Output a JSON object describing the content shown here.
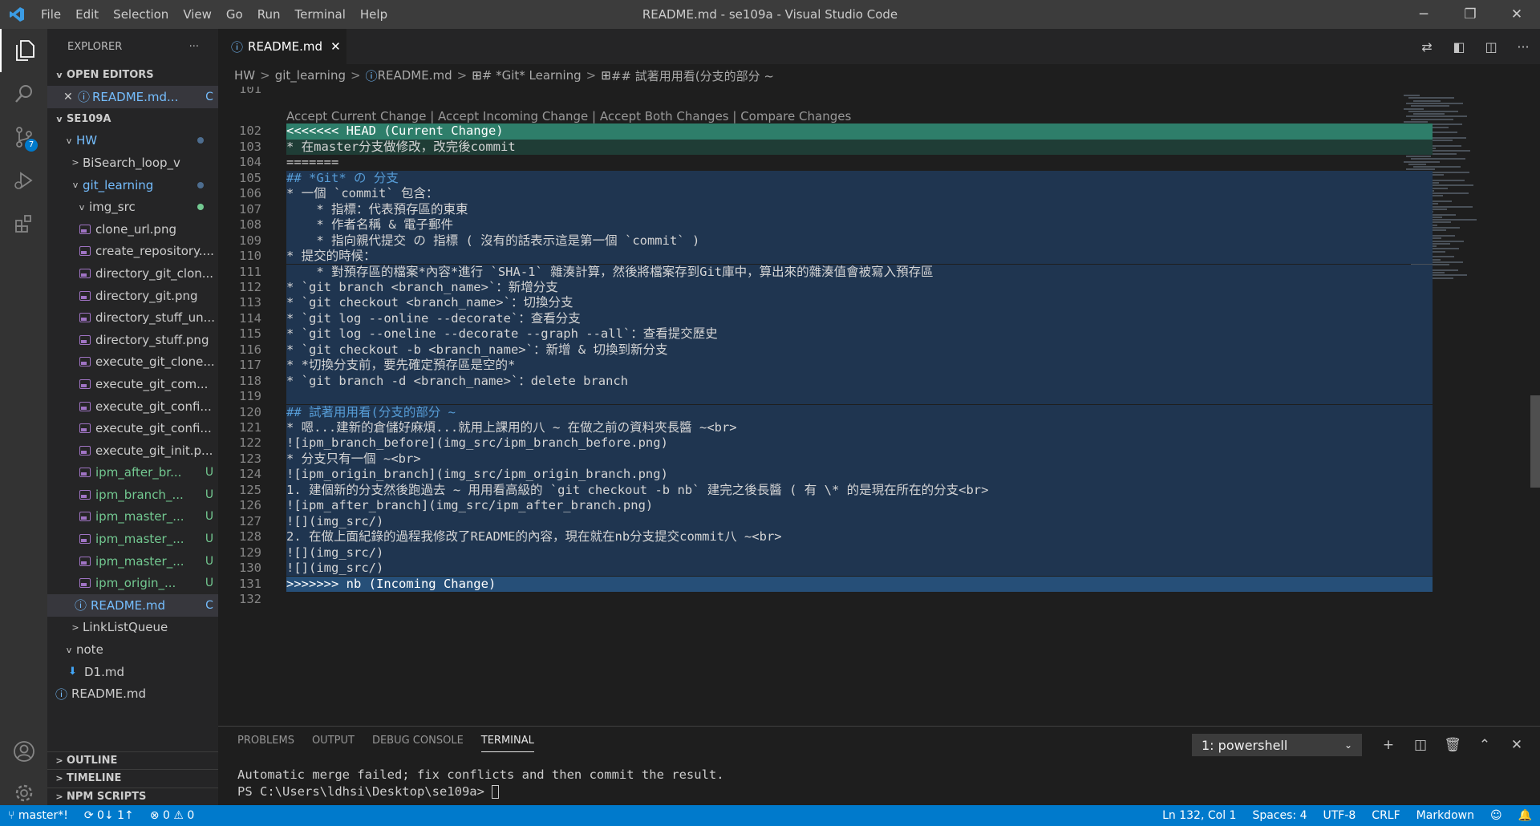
{
  "window_title": "README.md - se109a - Visual Studio Code",
  "menu": [
    "File",
    "Edit",
    "Selection",
    "View",
    "Go",
    "Run",
    "Terminal",
    "Help"
  ],
  "explorer": {
    "title": "EXPLORER",
    "more": "···",
    "open_editors_label": "OPEN EDITORS",
    "open_editor": {
      "name": "README.md...",
      "status": "C"
    },
    "workspace_label": "SE109A",
    "tree": [
      {
        "label": "HW",
        "indent": 18,
        "chevron": "v",
        "kind": "folder",
        "color": "#75beff",
        "dot": "#4d6d8f"
      },
      {
        "label": "BiSearch_loop_v",
        "indent": 26,
        "chevron": ">",
        "kind": "folder",
        "color": "#cccccc"
      },
      {
        "label": "git_learning",
        "indent": 26,
        "chevron": "v",
        "kind": "folder",
        "color": "#75beff",
        "dot": "#4d6d8f"
      },
      {
        "label": "img_src",
        "indent": 34,
        "chevron": "v",
        "kind": "folder",
        "color": "#cccccc",
        "dot": "#73c991"
      },
      {
        "label": "clone_url.png",
        "indent": 40,
        "kind": "file",
        "color": "#cccccc"
      },
      {
        "label": "create_repository....",
        "indent": 40,
        "kind": "file",
        "color": "#cccccc"
      },
      {
        "label": "directory_git_clon...",
        "indent": 40,
        "kind": "file",
        "color": "#cccccc"
      },
      {
        "label": "directory_git.png",
        "indent": 40,
        "kind": "file",
        "color": "#cccccc"
      },
      {
        "label": "directory_stuff_un...",
        "indent": 40,
        "kind": "file",
        "color": "#cccccc"
      },
      {
        "label": "directory_stuff.png",
        "indent": 40,
        "kind": "file",
        "color": "#cccccc"
      },
      {
        "label": "execute_git_clone...",
        "indent": 40,
        "kind": "file",
        "color": "#cccccc"
      },
      {
        "label": "execute_git_com...",
        "indent": 40,
        "kind": "file",
        "color": "#cccccc"
      },
      {
        "label": "execute_git_confi...",
        "indent": 40,
        "kind": "file",
        "color": "#cccccc"
      },
      {
        "label": "execute_git_confi...",
        "indent": 40,
        "kind": "file",
        "color": "#cccccc"
      },
      {
        "label": "execute_git_init.p...",
        "indent": 40,
        "kind": "file",
        "color": "#cccccc"
      },
      {
        "label": "ipm_after_br...",
        "indent": 40,
        "kind": "file",
        "color": "#73c991",
        "status": "U"
      },
      {
        "label": "ipm_branch_...",
        "indent": 40,
        "kind": "file",
        "color": "#73c991",
        "status": "U"
      },
      {
        "label": "ipm_master_...",
        "indent": 40,
        "kind": "file",
        "color": "#73c991",
        "status": "U"
      },
      {
        "label": "ipm_master_...",
        "indent": 40,
        "kind": "file",
        "color": "#73c991",
        "status": "U"
      },
      {
        "label": "ipm_master_...",
        "indent": 40,
        "kind": "file",
        "color": "#73c991",
        "status": "U"
      },
      {
        "label": "ipm_origin_...",
        "indent": 40,
        "kind": "file",
        "color": "#73c991",
        "status": "U"
      },
      {
        "label": "README.md",
        "indent": 34,
        "kind": "info",
        "color": "#75beff",
        "status": "C",
        "selected": true
      },
      {
        "label": "LinkListQueue",
        "indent": 26,
        "chevron": ">",
        "kind": "folder",
        "color": "#cccccc"
      },
      {
        "label": "note",
        "indent": 18,
        "chevron": "v",
        "kind": "folder",
        "color": "#cccccc"
      },
      {
        "label": "D1.md",
        "indent": 26,
        "kind": "md",
        "color": "#cccccc"
      },
      {
        "label": "README.md",
        "indent": 10,
        "kind": "info",
        "color": "#cccccc"
      }
    ],
    "bottom_sections": [
      "OUTLINE",
      "TIMELINE",
      "NPM SCRIPTS"
    ]
  },
  "activity": {
    "scm_badge": "7"
  },
  "tab": {
    "label": "README.md",
    "close": "✕"
  },
  "breadcrumbs": [
    "HW",
    "git_learning",
    "README.md",
    "# *Git* Learning",
    "## 試著用用看(分支的部分 ~"
  ],
  "codelens": "Accept Current Change | Accept Incoming Change | Accept Both Changes | Compare Changes",
  "lines": [
    {
      "n": "101",
      "t": "",
      "bg": ""
    },
    {
      "n": "102",
      "t": "<<<<<<< HEAD (Current Change)",
      "bg": "cur"
    },
    {
      "n": "103",
      "t": "* 在master分支做修改，改完後commit",
      "bg": "curb"
    },
    {
      "n": "104",
      "t": "=======",
      "bg": ""
    },
    {
      "n": "105",
      "t": "## *Git* の 分支",
      "bg": "incb",
      "cls": "kw"
    },
    {
      "n": "106",
      "t": "* 一個 `commit` 包含：",
      "bg": "incb"
    },
    {
      "n": "107",
      "t": "    * 指標：代表預存區的東東",
      "bg": "incb"
    },
    {
      "n": "108",
      "t": "    * 作者名稱 & 電子郵件",
      "bg": "incb"
    },
    {
      "n": "109",
      "t": "    * 指向親代提交 の 指標 ( 沒有的話表示這是第一個 `commit` )",
      "bg": "incb"
    },
    {
      "n": "110",
      "t": "* 提交的時候：",
      "bg": "incb"
    },
    {
      "n": "111",
      "t": "    * 對預存區的檔案*內容*進行 `SHA-1` 雜湊計算，然後將檔案存到Git庫中，算出來的雜湊值會被寫入預存區",
      "bg": "incb"
    },
    {
      "n": "112",
      "t": "* `git branch <branch_name>`：新增分支",
      "bg": "incb"
    },
    {
      "n": "113",
      "t": "* `git checkout <branch_name>`：切換分支",
      "bg": "incb"
    },
    {
      "n": "114",
      "t": "* `git log --online --decorate`：查看分支",
      "bg": "incb"
    },
    {
      "n": "115",
      "t": "* `git log --oneline --decorate --graph --all`：查看提交歷史",
      "bg": "incb"
    },
    {
      "n": "116",
      "t": "* `git checkout -b <branch_name>`：新增 & 切換到新分支",
      "bg": "incb"
    },
    {
      "n": "117",
      "t": "* *切換分支前，要先確定預存區是空的*",
      "bg": "incb"
    },
    {
      "n": "118",
      "t": "* `git branch -d <branch_name>`：delete branch",
      "bg": "incb"
    },
    {
      "n": "119",
      "t": "",
      "bg": "incb"
    },
    {
      "n": "120",
      "t": "## 試著用用看(分支的部分 ~",
      "bg": "incb",
      "cls": "kw"
    },
    {
      "n": "121",
      "t": "* 嗯...建新的倉儲好麻煩...就用上課用的八 ~ 在做之前の資料夾長醬 ~<br>",
      "bg": "incb"
    },
    {
      "n": "122",
      "t": "![ipm_branch_before](img_src/ipm_branch_before.png)",
      "bg": "incb"
    },
    {
      "n": "123",
      "t": "* 分支只有一個 ~<br>",
      "bg": "incb"
    },
    {
      "n": "124",
      "t": "![ipm_origin_branch](img_src/ipm_origin_branch.png)",
      "bg": "incb"
    },
    {
      "n": "125",
      "t": "1. 建個新的分支然後跑過去 ~ 用用看高級的 `git checkout -b nb` 建完之後長醬 ( 有 \\* 的是現在所在的分支<br>",
      "bg": "incb"
    },
    {
      "n": "126",
      "t": "![ipm_after_branch](img_src/ipm_after_branch.png)",
      "bg": "incb"
    },
    {
      "n": "127",
      "t": "![](img_src/)",
      "bg": "incb"
    },
    {
      "n": "128",
      "t": "2. 在做上面紀錄的過程我修改了README的內容，現在就在nb分支提交commit八 ~<br>",
      "bg": "incb"
    },
    {
      "n": "129",
      "t": "![](img_src/)",
      "bg": "incb"
    },
    {
      "n": "130",
      "t": "![](img_src/)",
      "bg": "incb"
    },
    {
      "n": "131",
      "t": ">>>>>>> nb (Incoming Change)",
      "bg": "inc"
    },
    {
      "n": "132",
      "t": "",
      "bg": ""
    }
  ],
  "panel": {
    "tabs": [
      "PROBLEMS",
      "OUTPUT",
      "DEBUG CONSOLE",
      "TERMINAL"
    ],
    "active_tab": "TERMINAL",
    "terminal_select": "1: powershell",
    "terminal_lines": [
      "Automatic merge failed; fix conflicts and then commit the result.",
      "PS C:\\Users\\ldhsi\\Desktop\\se109a> "
    ]
  },
  "status": {
    "branch": "master*!",
    "sync": "0↓ 1↑",
    "errors": "0",
    "warnings": "0",
    "position": "Ln 132, Col 1",
    "spaces": "Spaces: 4",
    "encoding": "UTF-8",
    "eol": "CRLF",
    "language": "Markdown"
  },
  "colors": {
    "accent": "#007acc",
    "current": "#2e7e6a",
    "incoming": "#264f78"
  }
}
